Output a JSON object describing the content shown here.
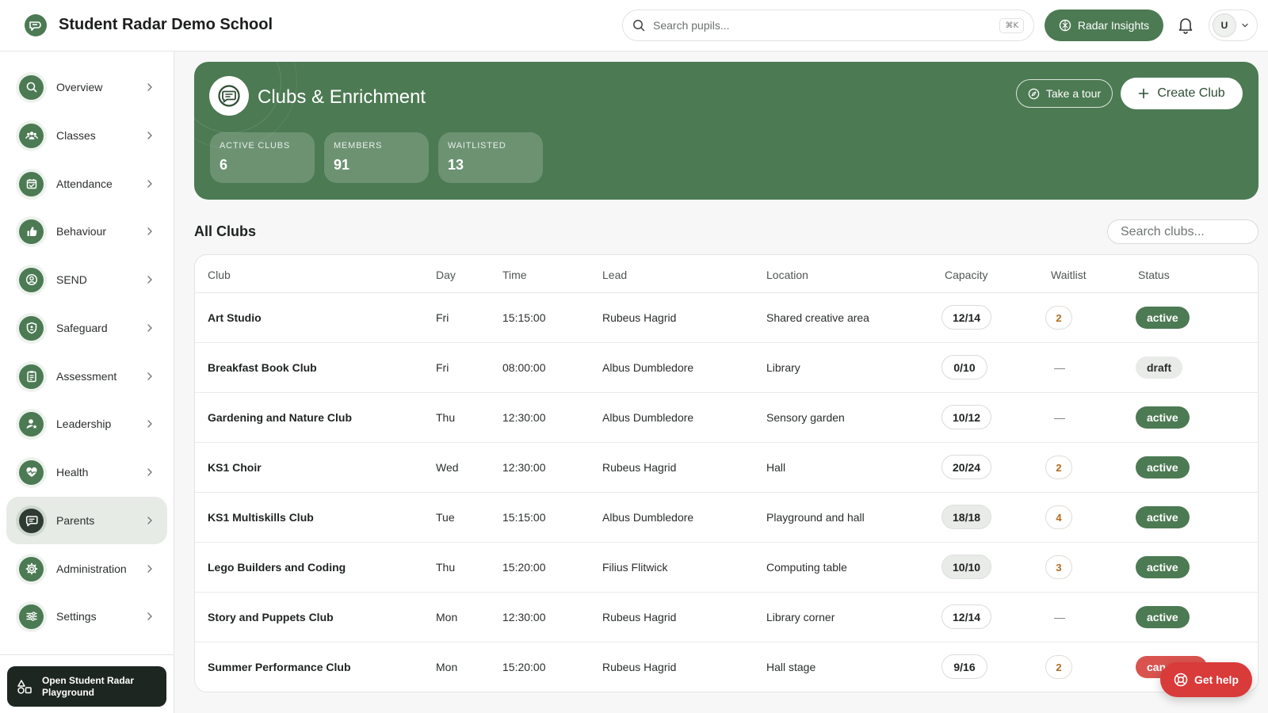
{
  "header": {
    "school_name": "Student Radar Demo School",
    "search_placeholder": "Search pupils...",
    "search_shortcut": "⌘K",
    "insights_label": "Radar Insights",
    "user_initial": "U"
  },
  "sidebar": {
    "items": [
      {
        "label": "Overview",
        "icon": "search-icon"
      },
      {
        "label": "Classes",
        "icon": "users-icon"
      },
      {
        "label": "Attendance",
        "icon": "calendar-check-icon"
      },
      {
        "label": "Behaviour",
        "icon": "thumbs-up-icon"
      },
      {
        "label": "SEND",
        "icon": "user-circle-icon"
      },
      {
        "label": "Safeguard",
        "icon": "shield-icon"
      },
      {
        "label": "Assessment",
        "icon": "clipboard-icon"
      },
      {
        "label": "Leadership",
        "icon": "user-star-icon"
      },
      {
        "label": "Health",
        "icon": "heart-pulse-icon"
      },
      {
        "label": "Parents",
        "icon": "message-icon",
        "active": true
      },
      {
        "label": "Administration",
        "icon": "gear-icon"
      },
      {
        "label": "Settings",
        "icon": "sliders-icon"
      }
    ],
    "playground_label_1": "Open Student Radar",
    "playground_label_2": "Playground"
  },
  "hero": {
    "title": "Clubs & Enrichment",
    "tour_label": "Take a tour",
    "create_label": "Create Club",
    "stats": [
      {
        "label": "ACTIVE CLUBS",
        "value": "6"
      },
      {
        "label": "MEMBERS",
        "value": "91"
      },
      {
        "label": "WAITLISTED",
        "value": "13"
      }
    ]
  },
  "clubs": {
    "title": "All Clubs",
    "search_placeholder": "Search clubs...",
    "columns": [
      "Club",
      "Day",
      "Time",
      "Lead",
      "Location",
      "Capacity",
      "Waitlist",
      "Status"
    ],
    "rows": [
      {
        "club": "Art Studio",
        "day": "Fri",
        "time": "15:15:00",
        "lead": "Rubeus Hagrid",
        "location": "Shared creative area",
        "capacity": "12/14",
        "full": false,
        "waitlist": "2",
        "status": "active"
      },
      {
        "club": "Breakfast Book Club",
        "day": "Fri",
        "time": "08:00:00",
        "lead": "Albus Dumbledore",
        "location": "Library",
        "capacity": "0/10",
        "full": false,
        "waitlist": "—",
        "status": "draft"
      },
      {
        "club": "Gardening and Nature Club",
        "day": "Thu",
        "time": "12:30:00",
        "lead": "Albus Dumbledore",
        "location": "Sensory garden",
        "capacity": "10/12",
        "full": false,
        "waitlist": "—",
        "status": "active"
      },
      {
        "club": "KS1 Choir",
        "day": "Wed",
        "time": "12:30:00",
        "lead": "Rubeus Hagrid",
        "location": "Hall",
        "capacity": "20/24",
        "full": false,
        "waitlist": "2",
        "status": "active"
      },
      {
        "club": "KS1 Multiskills Club",
        "day": "Tue",
        "time": "15:15:00",
        "lead": "Albus Dumbledore",
        "location": "Playground and hall",
        "capacity": "18/18",
        "full": true,
        "waitlist": "4",
        "status": "active"
      },
      {
        "club": "Lego Builders and Coding",
        "day": "Thu",
        "time": "15:20:00",
        "lead": "Filius Flitwick",
        "location": "Computing table",
        "capacity": "10/10",
        "full": true,
        "waitlist": "3",
        "status": "active"
      },
      {
        "club": "Story and Puppets Club",
        "day": "Mon",
        "time": "12:30:00",
        "lead": "Rubeus Hagrid",
        "location": "Library corner",
        "capacity": "12/14",
        "full": false,
        "waitlist": "—",
        "status": "active"
      },
      {
        "club": "Summer Performance Club",
        "day": "Mon",
        "time": "15:20:00",
        "lead": "Rubeus Hagrid",
        "location": "Hall stage",
        "capacity": "9/16",
        "full": false,
        "waitlist": "2",
        "status": "cancelled"
      }
    ]
  },
  "help": {
    "label": "Get help"
  },
  "colors": {
    "brand": "#4c7a53",
    "danger": "#d93a3a",
    "waitlist": "#b26a1f"
  }
}
